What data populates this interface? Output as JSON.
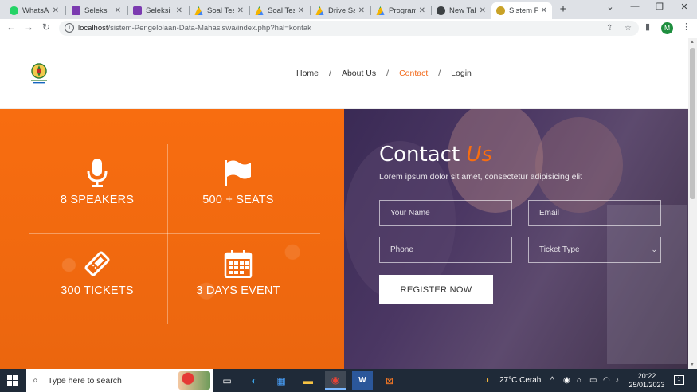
{
  "browser": {
    "tabs": [
      {
        "title": "WhatsApp",
        "favicon_color": "#25d366",
        "active": false
      },
      {
        "title": "Seleksi P",
        "favicon_color": "#7b3ab0",
        "active": false
      },
      {
        "title": "Seleksi P",
        "favicon_color": "#7b3ab0",
        "active": false
      },
      {
        "title": "Soal Tes",
        "favicon_color": "#f4b400",
        "active": false
      },
      {
        "title": "Soal Tes",
        "favicon_color": "#f4b400",
        "active": false
      },
      {
        "title": "Drive Sa",
        "favicon_color": "#f4b400",
        "active": false
      },
      {
        "title": "Program",
        "favicon_color": "#f4b400",
        "active": false
      },
      {
        "title": "New Tab",
        "favicon_color": "#3c4043",
        "active": false
      },
      {
        "title": "Sistem P",
        "favicon_color": "#c9a227",
        "active": true
      }
    ],
    "new_tab_label": "+",
    "url_host": "localhost",
    "url_path": "/sistem-Pengelolaan-Data-Mahasiswa/index.php?hal=kontak",
    "profile_initial": "M"
  },
  "header": {
    "logo_icon": "university-logo-icon",
    "nav": [
      {
        "label": "Home",
        "active": false
      },
      {
        "label": "About Us",
        "active": false
      },
      {
        "label": "Contact",
        "active": true
      },
      {
        "label": "Login",
        "active": false
      }
    ],
    "nav_separator": "/"
  },
  "stats": [
    {
      "icon": "microphone-icon",
      "label": "8 SPEAKERS"
    },
    {
      "icon": "flag-icon",
      "label": "500 + SEATS"
    },
    {
      "icon": "ticket-icon",
      "label": "300 TICKETS"
    },
    {
      "icon": "calendar-icon",
      "label": "3 DAYS EVENT"
    }
  ],
  "contact": {
    "title_main": "Contact",
    "title_accent": "Us",
    "subtitle": "Lorem ipsum dolor sit amet, consectetur adipisicing elit",
    "name_placeholder": "Your Name",
    "email_placeholder": "Email",
    "phone_placeholder": "Phone",
    "ticket_placeholder": "Ticket Type",
    "register_label": "REGISTER NOW"
  },
  "colors": {
    "accent": "#f86d10",
    "taskbar": "#1f2a38"
  },
  "taskbar": {
    "search_placeholder": "Type here to search",
    "weather": "27°C  Cerah",
    "time": "20:22",
    "date": "25/01/2023",
    "notification_count": "1"
  }
}
